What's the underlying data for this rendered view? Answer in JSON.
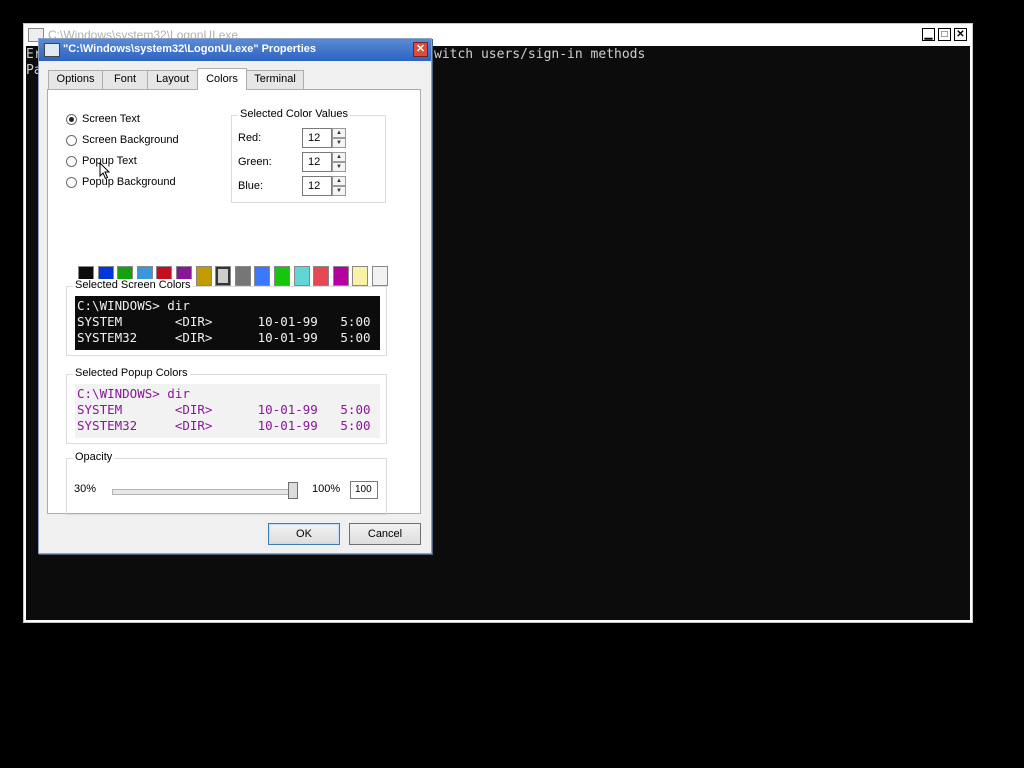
{
  "console": {
    "title": "C:\\Windows\\system32\\LogonUI.exe",
    "lines": [
      "Er",
      "Pa"
    ],
    "visible_text": "witch users/sign-in methods"
  },
  "dialog": {
    "title": "\"C:\\Windows\\system32\\LogonUI.exe\" Properties",
    "close_glyph": "✕",
    "tabs": [
      "Options",
      "Font",
      "Layout",
      "Colors",
      "Terminal"
    ],
    "active_tab": "Colors",
    "radios": [
      {
        "label": "Screen Text",
        "checked": true
      },
      {
        "label": "Screen Background",
        "checked": false
      },
      {
        "label": "Popup Text",
        "checked": false
      },
      {
        "label": "Popup Background",
        "checked": false
      }
    ],
    "color_values": {
      "group_label": "Selected Color Values",
      "red_label": "Red:",
      "red": "12",
      "green_label": "Green:",
      "green": "12",
      "blue_label": "Blue:",
      "blue": "12",
      "up_glyph": "▲",
      "down_glyph": "▼"
    },
    "palette": [
      "#0c0c0c",
      "#0037da",
      "#13a10e",
      "#3a96dd",
      "#c50f1f",
      "#881798",
      "#c19c00",
      "#cccccc",
      "#767676",
      "#3b78ff",
      "#16c60c",
      "#61d6d6",
      "#e74856",
      "#b4009e",
      "#f9f1a5",
      "#f2f2f2"
    ],
    "palette_selected_index": 7,
    "screen_colors": {
      "group_label": "Selected Screen Colors",
      "background": "#0c0c0c",
      "foreground": "#f2f2f2",
      "lines": [
        "C:\\WINDOWS> dir",
        "SYSTEM       <DIR>      10-01-99   5:00",
        "SYSTEM32     <DIR>      10-01-99   5:00"
      ]
    },
    "popup_colors": {
      "group_label": "Selected Popup Colors",
      "background": "#f2f2f2",
      "foreground": "#881798",
      "lines": [
        "C:\\WINDOWS> dir",
        "SYSTEM       <DIR>      10-01-99   5:00",
        "SYSTEM32     <DIR>      10-01-99   5:00"
      ]
    },
    "opacity": {
      "group_label": "Opacity",
      "min_label": "30%",
      "max_label": "100%",
      "value": "100",
      "level_fraction": 1.0
    },
    "ok_label": "OK",
    "cancel_label": "Cancel"
  },
  "window_controls": {
    "minimize": "▁",
    "maximize": "□",
    "close": "✕"
  }
}
